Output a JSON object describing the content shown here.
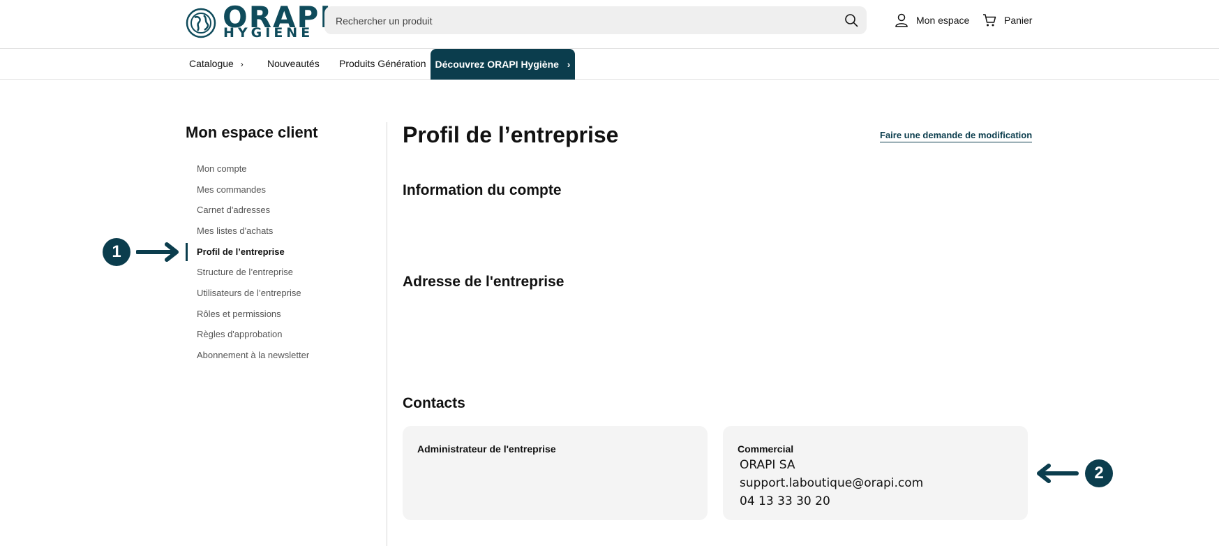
{
  "header": {
    "logo_line1": "ORAPI",
    "logo_line2": "HYGIÈNE",
    "search_placeholder": "Rechercher un produit",
    "account_label": "Mon espace",
    "cart_label": "Panier"
  },
  "nav": {
    "catalogue": "Catalogue",
    "catalogue_chevron": "›",
    "nouveautes": "Nouveautés",
    "produits_generation": "Produits Génération",
    "decouvrez": "Découvrez ORAPI Hygiène",
    "decouvrez_chevron": "›"
  },
  "sidebar": {
    "title": "Mon espace client",
    "items": [
      {
        "label": "Mon compte"
      },
      {
        "label": "Mes commandes"
      },
      {
        "label": "Carnet d'adresses"
      },
      {
        "label": "Mes listes d'achats"
      },
      {
        "label": "Profil de l’entreprise"
      },
      {
        "label": "Structure de l’entreprise"
      },
      {
        "label": "Utilisateurs de l’entreprise"
      },
      {
        "label": "Rôles et permissions"
      },
      {
        "label": "Règles d'approbation"
      },
      {
        "label": "Abonnement à la newsletter"
      }
    ],
    "active_index": 4
  },
  "main": {
    "title": "Profil de l’entreprise",
    "edit_link": "Faire une demande de modification",
    "section_account": "Information du compte",
    "section_address": "Adresse de l'entreprise",
    "section_contacts": "Contacts",
    "contacts": [
      {
        "title": "Administrateur de l'entreprise"
      },
      {
        "title": "Commercial",
        "name": "ORAPI SA",
        "email": "support.laboutique@orapi.com",
        "phone": "04 13 33 30 20"
      }
    ]
  },
  "annotations": {
    "badge1": "1",
    "badge2": "2"
  },
  "colors": {
    "brand": "#0b3d4d",
    "search_bg": "#efefef",
    "card_bg": "#f4f4f4"
  }
}
